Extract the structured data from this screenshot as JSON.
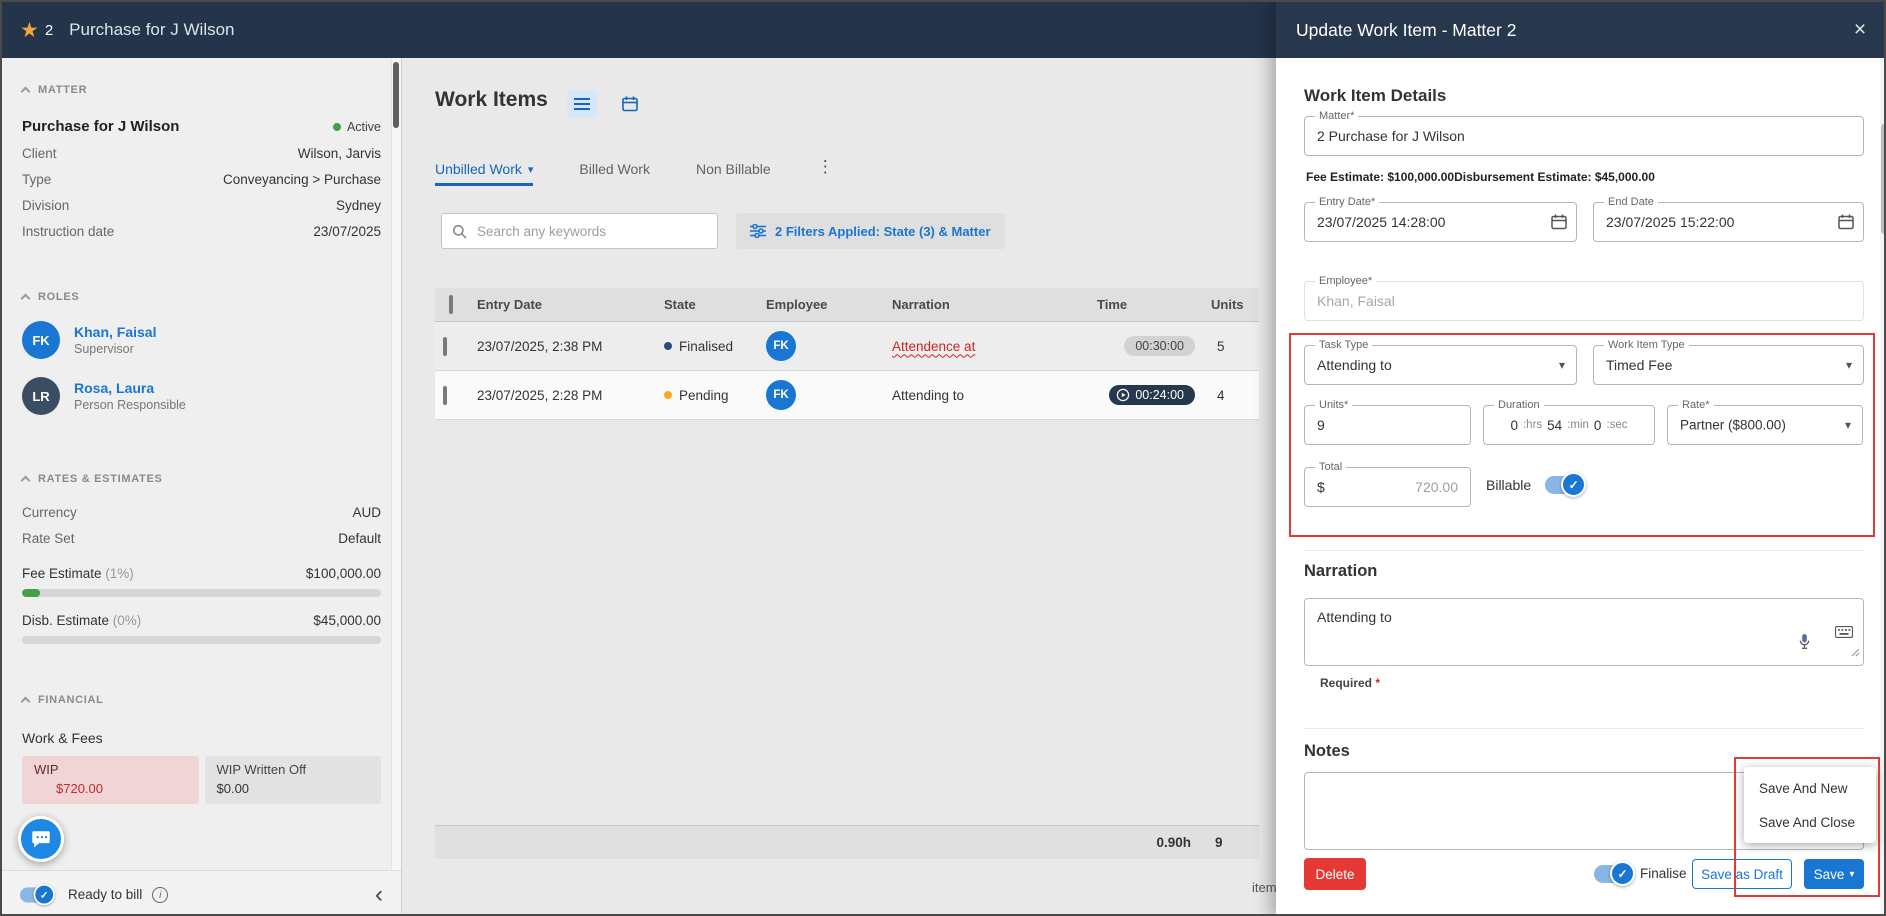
{
  "icons": {
    "star": "★",
    "close": "×",
    "caret_down": "▾",
    "dots_vertical": "⋮",
    "chevron_left": "‹",
    "check": "✓",
    "info": "i"
  },
  "colors": {
    "accent_blue": "#1976d2",
    "header_navy": "#24344a",
    "danger_red": "#e53935",
    "annotation_red": "#e53935",
    "active_green": "#43a047",
    "pending_orange": "#f9a825",
    "finalised_navy": "#2c4a7c"
  },
  "app_header": {
    "badge_count": "2",
    "title": "Purchase for J Wilson"
  },
  "sidebar": {
    "sections": {
      "matter": "MATTER",
      "roles": "ROLES",
      "rates": "RATES & ESTIMATES",
      "financial": "FINANCIAL"
    },
    "matter": {
      "name": "Purchase for J Wilson",
      "status": "Active",
      "client_label": "Client",
      "client_value": "Wilson, Jarvis",
      "type_label": "Type",
      "type_value": "Conveyancing > Purchase",
      "division_label": "Division",
      "division_value": "Sydney",
      "instruction_label": "Instruction date",
      "instruction_value": "23/07/2025"
    },
    "roles": [
      {
        "initials": "FK",
        "name": "Khan, Faisal",
        "role": "Supervisor"
      },
      {
        "initials": "LR",
        "name": "Rosa, Laura",
        "role": "Person Responsible"
      }
    ],
    "rates": {
      "currency_label": "Currency",
      "currency_value": "AUD",
      "rateset_label": "Rate Set",
      "rateset_value": "Default",
      "fee_label": "Fee Estimate",
      "fee_pct": "(1%)",
      "fee_value": "$100,000.00",
      "disb_label": "Disb. Estimate",
      "disb_pct": "(0%)",
      "disb_value": "$45,000.00"
    },
    "financial": {
      "heading": "Work & Fees",
      "wip_label": "WIP",
      "wip_value": "$720.00",
      "wo_label": "WIP Written Off",
      "wo_value": "$0.00"
    },
    "footer": {
      "ready_to_bill": "Ready to bill"
    }
  },
  "main": {
    "title": "Work Items",
    "tabs": {
      "unbilled": "Unbilled Work",
      "billed": "Billed Work",
      "nonbillable": "Non Billable"
    },
    "search_placeholder": "Search any keywords",
    "filter_chip": "2 Filters Applied: State (3) & Matter",
    "table": {
      "col_entry": "Entry Date",
      "col_state": "State",
      "col_employee": "Employee",
      "col_narration": "Narration",
      "col_time": "Time",
      "col_units": "Units",
      "rows": [
        {
          "entry": "23/07/2025, 2:38 PM",
          "state": "Finalised",
          "initials": "FK",
          "narration": "Attendence at",
          "time": "00:30:00",
          "units": "5"
        },
        {
          "entry": "23/07/2025, 2:28 PM",
          "state": "Pending",
          "initials": "FK",
          "narration": "Attending to",
          "time": "00:24:00",
          "units": "4"
        }
      ],
      "total_time": "0.90h",
      "total_units": "9"
    },
    "pagination": "items per page"
  },
  "modal": {
    "title": "Update Work Item - Matter 2",
    "details_heading": "Work Item Details",
    "matter_label": "Matter*",
    "matter_value": "2 Purchase for J Wilson",
    "fee_estimate": "Fee Estimate: $100,000.00",
    "disb_estimate": "Disbursement Estimate: $45,000.00",
    "entry_label": "Entry Date*",
    "entry_value": "23/07/2025 14:28:00",
    "end_label": "End Date",
    "end_value": "23/07/2025 15:22:00",
    "employee_label": "Employee*",
    "employee_value": "Khan, Faisal",
    "task_label": "Task Type",
    "task_value": "Attending to",
    "type_label": "Work Item Type",
    "type_value": "Timed Fee",
    "units_label": "Units*",
    "units_value": "9",
    "duration_label": "Duration",
    "duration_h": "0",
    "duration_h_unit": ":hrs",
    "duration_m": "54",
    "duration_m_unit": ":min",
    "duration_s": "0",
    "duration_s_unit": ":sec",
    "rate_label": "Rate*",
    "rate_value": "Partner ($800.00)",
    "total_label": "Total",
    "total_prefix": "$",
    "total_value": "720.00",
    "billable_label": "Billable",
    "narration_heading": "Narration",
    "narration_value": "Attending to",
    "required_label": "Required",
    "required_star": "*",
    "notes_heading": "Notes",
    "menu": {
      "save_and_new": "Save And New",
      "save_and_close": "Save And Close"
    },
    "footer": {
      "delete": "Delete",
      "finalise": "Finalise",
      "save_as_draft": "Save as Draft",
      "save": "Save"
    }
  }
}
